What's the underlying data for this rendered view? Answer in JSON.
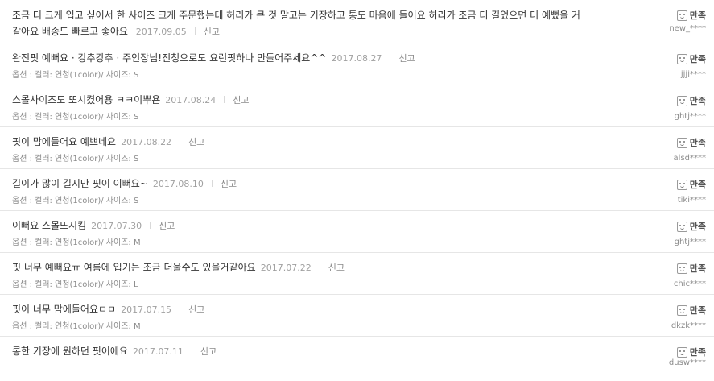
{
  "reviews": [
    {
      "text": "조금 더 크게 입고 싶어서 한 사이즈 크게 주문했는데 허리가 큰 것 말고는 기장하고 통도 마음에 들어요 허리가 조금 더 길었으면 더 예뻤을 거 같아요 배송도 빠르고 좋아요",
      "date": "2017.09.05",
      "report": "신고",
      "option": "",
      "rating": "만족",
      "user": "new_****"
    },
    {
      "text": "완전핏 예뻐요 · 강추강추 · 주인장님!진청으로도 요런핏하나 만들어주세요^^",
      "date": "2017.08.27",
      "report": "신고",
      "option": "옵션 : 컬러: 연청(1color)/ 사이즈: S",
      "rating": "만족",
      "user": "jjji****"
    },
    {
      "text": "스몰사이즈도 또시켰어용 ㅋㅋ이뿌욘",
      "date": "2017.08.24",
      "report": "신고",
      "option": "옵션 : 컬러: 연청(1color)/ 사이즈: S",
      "rating": "만족",
      "user": "ghtj****"
    },
    {
      "text": "핏이 맘에들어요 예쁘네요",
      "date": "2017.08.22",
      "report": "신고",
      "option": "옵션 : 컬러: 연청(1color)/ 사이즈: S",
      "rating": "만족",
      "user": "alsd****"
    },
    {
      "text": "길이가 많이 길지만 핏이 이뻐요~",
      "date": "2017.08.10",
      "report": "신고",
      "option": "옵션 : 컬러: 연청(1color)/ 사이즈: S",
      "rating": "만족",
      "user": "tiki****"
    },
    {
      "text": "이뻐요 스몰또시킴",
      "date": "2017.07.30",
      "report": "신고",
      "option": "옵션 : 컬러: 연청(1color)/ 사이즈: M",
      "rating": "만족",
      "user": "ghtj****"
    },
    {
      "text": "핏 너무 예뻐요ㅠ 여름에 입기는 조금 더울수도 있을거같아요",
      "date": "2017.07.22",
      "report": "신고",
      "option": "옵션 : 컬러: 연청(1color)/ 사이즈: L",
      "rating": "만족",
      "user": "chic****"
    },
    {
      "text": "핏이 너무 맘에들어요ㅁㅁ",
      "date": "2017.07.15",
      "report": "신고",
      "option": "옵션 : 컬러: 연청(1color)/ 사이즈: M",
      "rating": "만족",
      "user": "dkzk****"
    },
    {
      "text": "롱한 기장에 원하던 핏이에요",
      "date": "2017.07.11",
      "report": "신고",
      "option": "",
      "rating": "만족",
      "user": "dusw****"
    }
  ]
}
